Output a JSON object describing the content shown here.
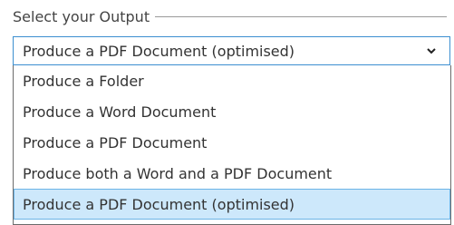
{
  "legend": {
    "label": "Select your Output"
  },
  "select": {
    "value": "Produce a PDF Document (optimised)",
    "icon": "chevron-down-icon"
  },
  "options": [
    {
      "label": "Produce a Folder",
      "selected": false
    },
    {
      "label": "Produce a Word Document",
      "selected": false
    },
    {
      "label": "Produce a PDF Document",
      "selected": false
    },
    {
      "label": "Produce both a Word and a PDF Document",
      "selected": false
    },
    {
      "label": "Produce a PDF Document (optimised)",
      "selected": true
    }
  ],
  "colors": {
    "select_border": "#3c8fd0",
    "selected_option_bg": "#cde8fb",
    "selected_option_border": "#6cb4e6"
  }
}
